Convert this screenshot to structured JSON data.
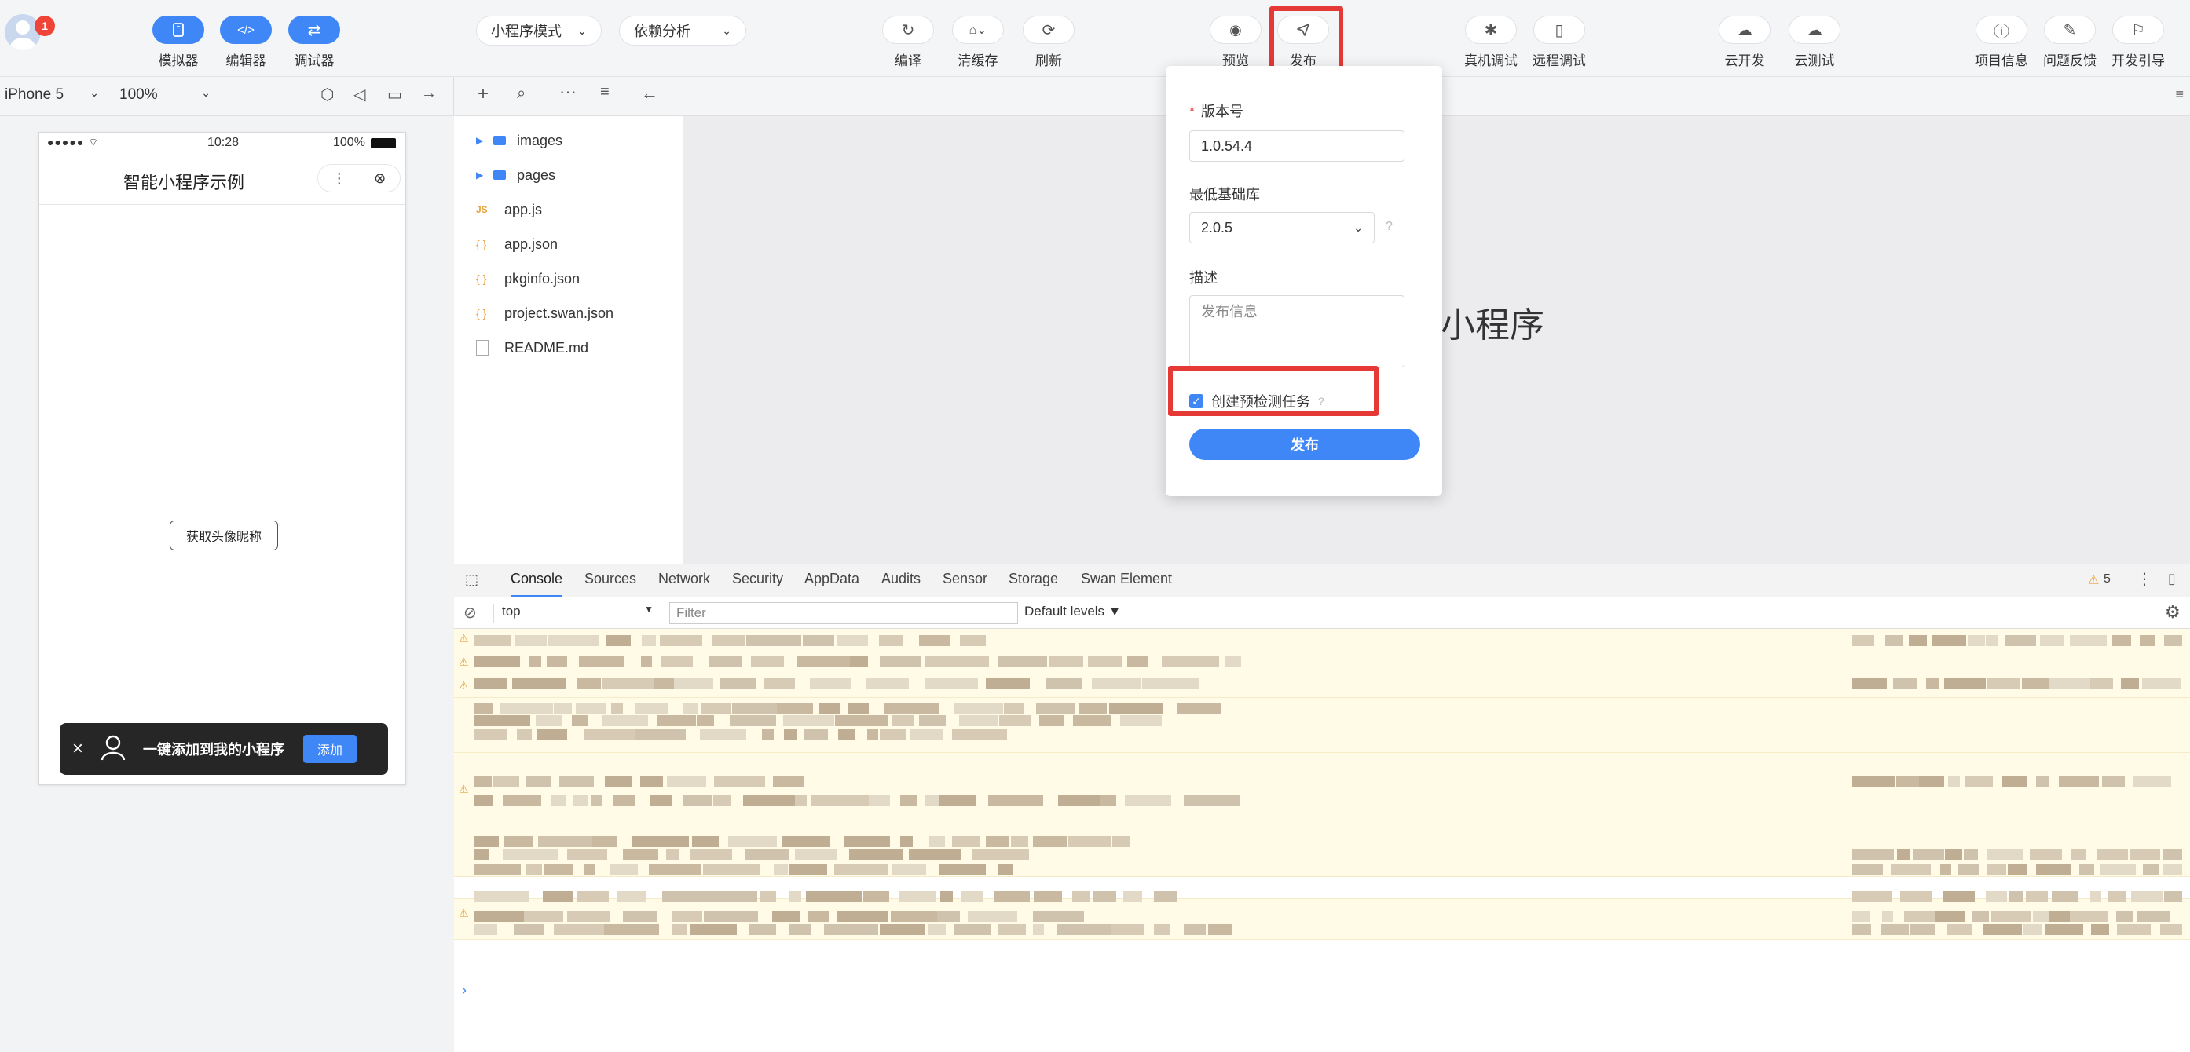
{
  "toolbar": {
    "badge_count": "1",
    "left_buttons": [
      "模拟器",
      "编辑器",
      "调试器"
    ],
    "mode_select": "小程序模式",
    "dep_select": "依赖分析",
    "mid_buttons": [
      "编译",
      "清缓存",
      "刷新"
    ],
    "preview": "预览",
    "publish": "发布",
    "device_buttons": [
      "真机调试",
      "远程调试"
    ],
    "cloud_buttons": [
      "云开发",
      "云测试"
    ],
    "right_buttons": [
      "项目信息",
      "问题反馈",
      "开发引导"
    ]
  },
  "simulator": {
    "device": "iPhone 5",
    "zoom": "100%",
    "status_time": "10:28",
    "battery": "100%",
    "page_title": "智能小程序示例",
    "center_button": "获取头像昵称",
    "banner_text": "一键添加到我的小程序",
    "banner_add": "添加"
  },
  "files": {
    "items": [
      {
        "name": "images",
        "type": "folder"
      },
      {
        "name": "pages",
        "type": "folder"
      },
      {
        "name": "app.js",
        "type": "js"
      },
      {
        "name": "app.json",
        "type": "json"
      },
      {
        "name": "pkginfo.json",
        "type": "json"
      },
      {
        "name": "project.swan.json",
        "type": "json"
      },
      {
        "name": "README.md",
        "type": "md"
      }
    ]
  },
  "editor": {
    "bg_text": "能小程序"
  },
  "publish_dialog": {
    "version_label": "版本号",
    "version_value": "1.0.54.4",
    "min_lib_label": "最低基础库",
    "min_lib_value": "2.0.5",
    "desc_label": "描述",
    "desc_placeholder": "发布信息",
    "precheck_label": "创建预检测任务",
    "precheck_checked": true,
    "submit": "发布"
  },
  "devtools": {
    "tabs": [
      "Console",
      "Sources",
      "Network",
      "Security",
      "AppData",
      "Audits",
      "Sensor",
      "Storage",
      "Swan Element"
    ],
    "active_tab": "Console",
    "warning_count": "5",
    "context": "top",
    "filter_placeholder": "Filter",
    "levels": "Default levels ▼"
  },
  "colors": {
    "accent": "#3f86f7",
    "highlight": "#e53935",
    "warn_bg": "#fffbe6"
  }
}
